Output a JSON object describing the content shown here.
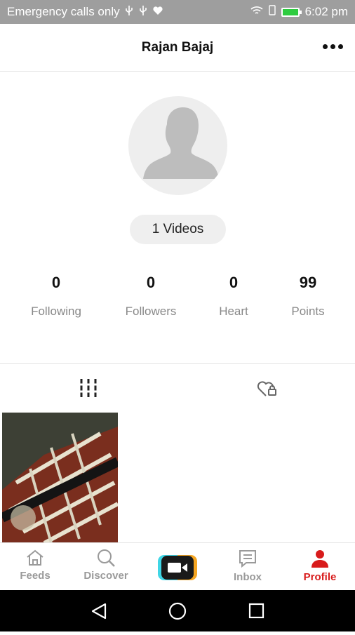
{
  "status_bar": {
    "left_text": "Emergency calls only",
    "time": "6:02 pm"
  },
  "header": {
    "title": "Rajan Bajaj"
  },
  "profile": {
    "videos_label": "1 Videos"
  },
  "stats": [
    {
      "value": "0",
      "label": "Following"
    },
    {
      "value": "0",
      "label": "Followers"
    },
    {
      "value": "0",
      "label": "Heart"
    },
    {
      "value": "99",
      "label": "Points"
    }
  ],
  "bottom_nav": {
    "feeds": "Feeds",
    "discover": "Discover",
    "inbox": "Inbox",
    "profile": "Profile",
    "active_color": "#d81b1b",
    "inactive_color": "#9a9a9a"
  },
  "icons": [
    "usb-icon",
    "heart-status-icon",
    "wifi-icon",
    "battery-icon",
    "more-icon",
    "grid-tab-icon",
    "liked-tab-icon",
    "home-icon",
    "search-icon",
    "video-camera-icon",
    "inbox-icon",
    "profile-icon",
    "back-icon",
    "home-circle-icon",
    "recents-icon"
  ]
}
